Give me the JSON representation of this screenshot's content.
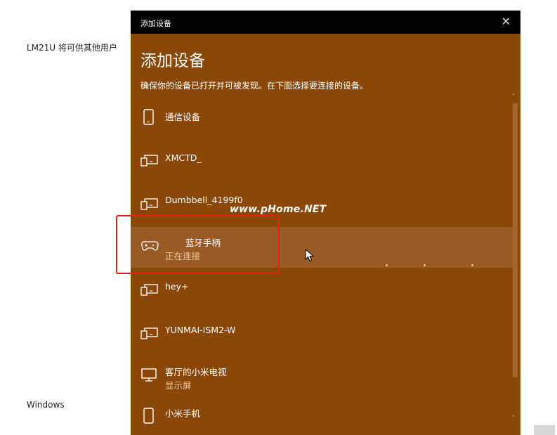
{
  "background": {
    "left_text": "LM21U 将可供其他用户",
    "bottom_text": "Windows"
  },
  "dialog": {
    "titlebar_title": "添加设备",
    "close_glyph": "✕",
    "heading": "添加设备",
    "subtitle": "确保你的设备已打开并可被发现。在下面选择要连接的设备。",
    "devices": [
      {
        "name": "通信设备",
        "status": "",
        "icon": "phone-icon"
      },
      {
        "name": "XMCTD_",
        "status": "",
        "icon": "device-icon"
      },
      {
        "name": "Dumbbell_4199f0",
        "status": "",
        "icon": "device-icon"
      },
      {
        "name": "蓝牙手柄",
        "status": "正在连接",
        "icon": "gamepad-icon"
      },
      {
        "name": "hey+",
        "status": "",
        "icon": "device-icon"
      },
      {
        "name": "YUNMAI-ISM2-W",
        "status": "",
        "icon": "device-icon"
      },
      {
        "name": "客厅的小米电视",
        "status": "显示屏",
        "icon": "monitor-icon"
      },
      {
        "name": "小米手机",
        "status": "",
        "icon": "phone-icon"
      }
    ]
  },
  "watermark": "www.pHome.NET",
  "colors": {
    "dialog_bg": "#8b4708",
    "highlight": "#9a5a25",
    "annotation": "#e5211d"
  }
}
